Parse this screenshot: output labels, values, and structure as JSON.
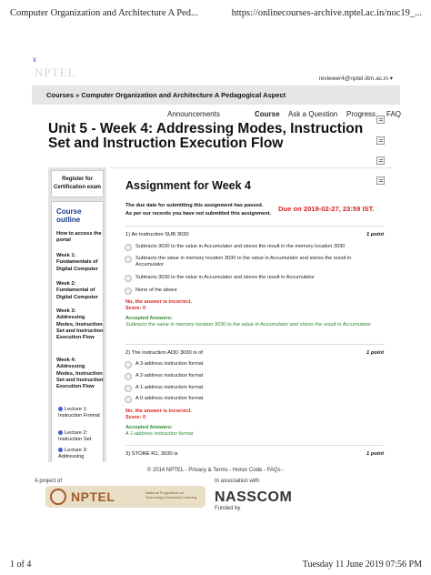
{
  "print": {
    "header_title": "Computer Organization and Architecture A Ped...",
    "header_url": "https://onlinecourses-archive.nptel.ac.in/noc19_...",
    "footer_page": "1 of 4",
    "footer_date": "Tuesday 11 June 2019 07:56 PM"
  },
  "top": {
    "close_glyph": "x",
    "logo_text": "NPTEL",
    "user_email": "reviewer4@nptel.iitm.ac.in ▾"
  },
  "breadcrumb": "Courses » Computer Organization and Architecture A Pedagogical Aspect",
  "course_nav": {
    "announcements": "Announcements",
    "course": "Course",
    "ask": "Ask a Question",
    "progress": "Progress",
    "faq": "FAQ"
  },
  "page_title": "Unit 5 - Week 4: Addressing Modes, Instruction Set and Instruction Execution Flow",
  "sidebar": {
    "register": "Register for Certification exam",
    "outline_title": "Course outline",
    "items": [
      "How to access the portal",
      "Week 1: Fundamentals of Digital Computer",
      "Week 2: Fundamental of Digital Computer",
      "Week 3: Addressing Modes, Instruction Set and Instruction Execution Flow",
      "Week 4: Addressing Modes, Instruction Set and Instruction Execution Flow"
    ],
    "lectures": [
      "Lecture 1: Instruction Format",
      "Lecture 2: Instruction Set",
      "Lecture 3: Addressing"
    ]
  },
  "assignment": {
    "title": "Assignment for Week 4",
    "due_passed": "The due date for submitting this assignment has passed.",
    "not_submitted": "As per our records you have not submitted this assignment.",
    "due_date": "Due on 2019-02-27, 23:59 IST.",
    "questions": [
      {
        "text": "1) An instruction SUB 3030",
        "points": "1 point",
        "options": [
          "Subtracts 3030 to the value in Accumulator and stores the result in the memory location 3030",
          "Subtracts the value in memory location 3030 to the value in Accumulator and stores the result in Accumulator",
          "Subtracts 3030 to the value in Accumulator and stores the result in Accumulator",
          "None of the above"
        ],
        "wrong": "No, the answer is incorrect.",
        "score": "Score: 0",
        "accepted_label": "Accepted Answers:",
        "accepted": "Subtracts the value in memory location 3030 to the value in Accumulator and stores the result in Accumulator"
      },
      {
        "text": "2) The instruction ADD 3030 is of",
        "points": "1 point",
        "options": [
          "A 3-address instruction format",
          "A 2-address instruction format",
          "A 1-address instruction format",
          "A 0-address instruction format"
        ],
        "wrong": "No, the answer is incorrect.",
        "score": "Score: 0",
        "accepted_label": "Accepted Answers:",
        "accepted": "A 1-address instruction format"
      },
      {
        "text": "3) STORE R1, 3030 is",
        "points": "1 point"
      }
    ]
  },
  "footer": {
    "copyright": "© 2014 NPTEL - Privacy & Terms - Honor Code - FAQs -",
    "project_of": "A project of",
    "association": "In association with",
    "funded_by": "Funded by",
    "nptel_word": "NPTEL",
    "nptel_sub": "National Programme on Technology Enhanced Learning",
    "nasscom": "NASSCOM"
  }
}
